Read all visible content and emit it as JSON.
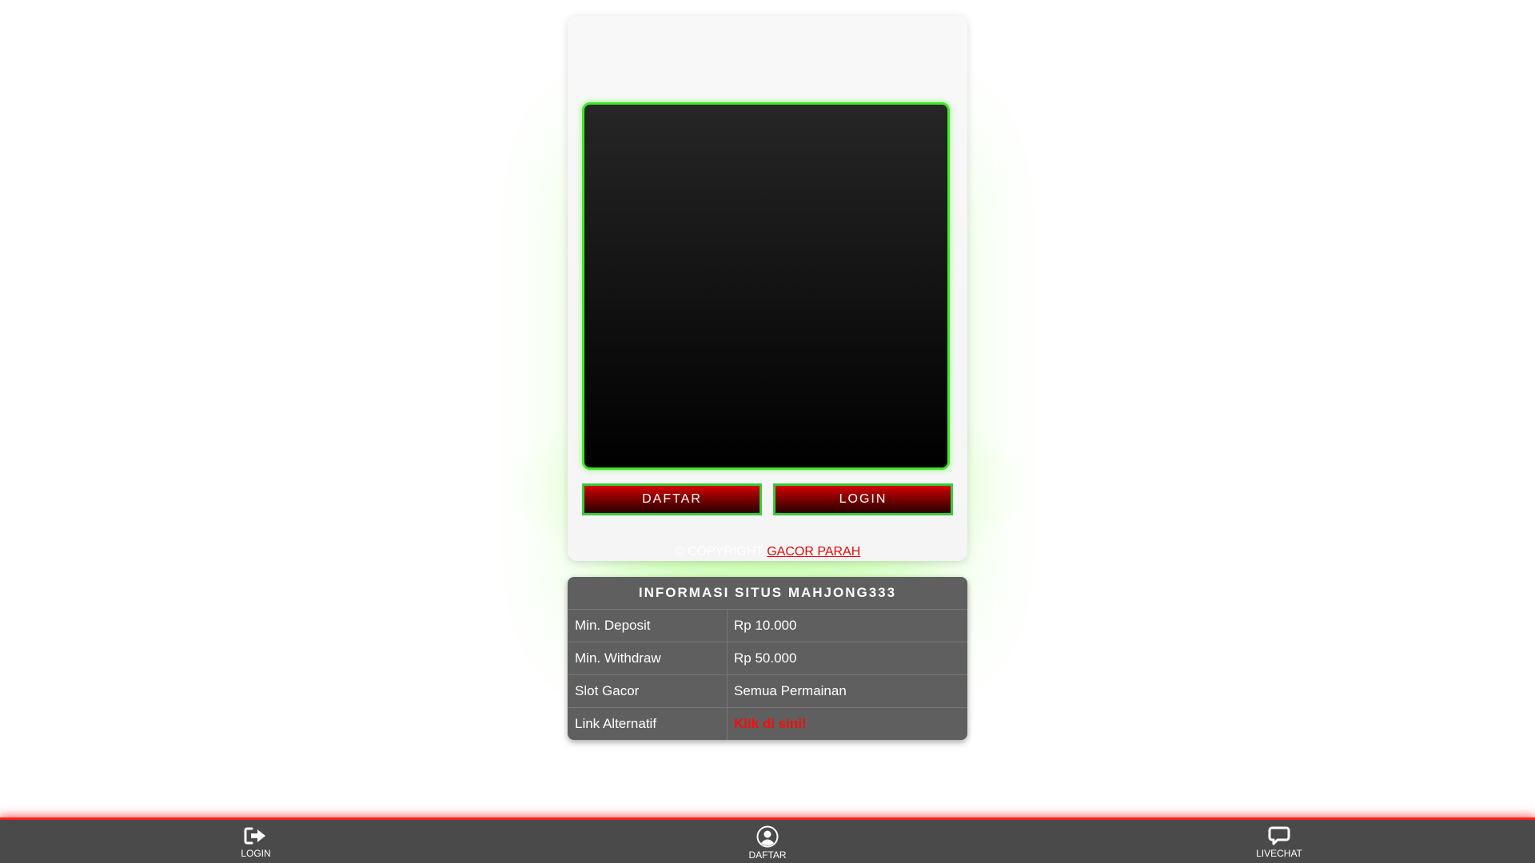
{
  "card": {
    "daftar_label": "DAFTAR",
    "login_label": "LOGIN",
    "copyright_prefix": "© COPYRIGHT ",
    "copyright_link": "GACOR PARAH"
  },
  "info": {
    "title": "INFORMASI SITUS MAHJONG333",
    "rows": [
      {
        "key": "Min. Deposit",
        "value": "Rp 10.000"
      },
      {
        "key": "Min. Withdraw",
        "value": "Rp 50.000"
      },
      {
        "key": "Slot Gacor",
        "value": "Semua Permainan"
      },
      {
        "key": "Link Alternatif",
        "value": "Klik di sini!"
      }
    ]
  },
  "bottom_nav": {
    "items": [
      {
        "label": "LOGIN",
        "icon": "login-icon"
      },
      {
        "label": "DAFTAR",
        "icon": "user-circle-icon"
      },
      {
        "label": "LIVECHAT",
        "icon": "chat-icon"
      }
    ]
  },
  "colors": {
    "accent_green": "#3ee820",
    "button_red": "#d40000",
    "link_red": "#e20a0a",
    "nav_bg": "#4a4a4a",
    "table_bg": "#5f5f5f"
  }
}
